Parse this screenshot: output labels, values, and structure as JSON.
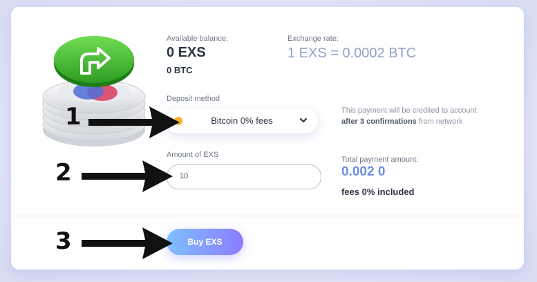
{
  "balance": {
    "label": "Available balance:",
    "exs": "0 EXS",
    "btc": "0 BTC"
  },
  "exchange": {
    "label": "Exchange rate:",
    "rate": "1 EXS = 0.0002 BTC"
  },
  "deposit": {
    "label": "Deposit method",
    "selected": "Bitcoin 0% fees",
    "note_prefix": "This payment will be credited to account ",
    "note_bold": "after 3 confirmations",
    "note_suffix": " from network"
  },
  "amount": {
    "label": "Amount of EXS",
    "value": "10"
  },
  "total": {
    "label": "Total payment amount:",
    "value": "0.002 0",
    "fees": "fees 0% included"
  },
  "buy_button": {
    "label": "Buy EXS"
  },
  "annotations": {
    "step1": "1",
    "step2": "2",
    "step3": "3"
  },
  "colors": {
    "accent": "#6f8ee6",
    "button_start": "#7fc0ff",
    "button_end": "#8b7cff",
    "coin_green": "#4fc53b"
  },
  "icons": {
    "logo": "coin-stack-arrow-icon",
    "select_chevron": "chevron-down-icon",
    "select_coin": "bitcoin-coin-icon"
  }
}
